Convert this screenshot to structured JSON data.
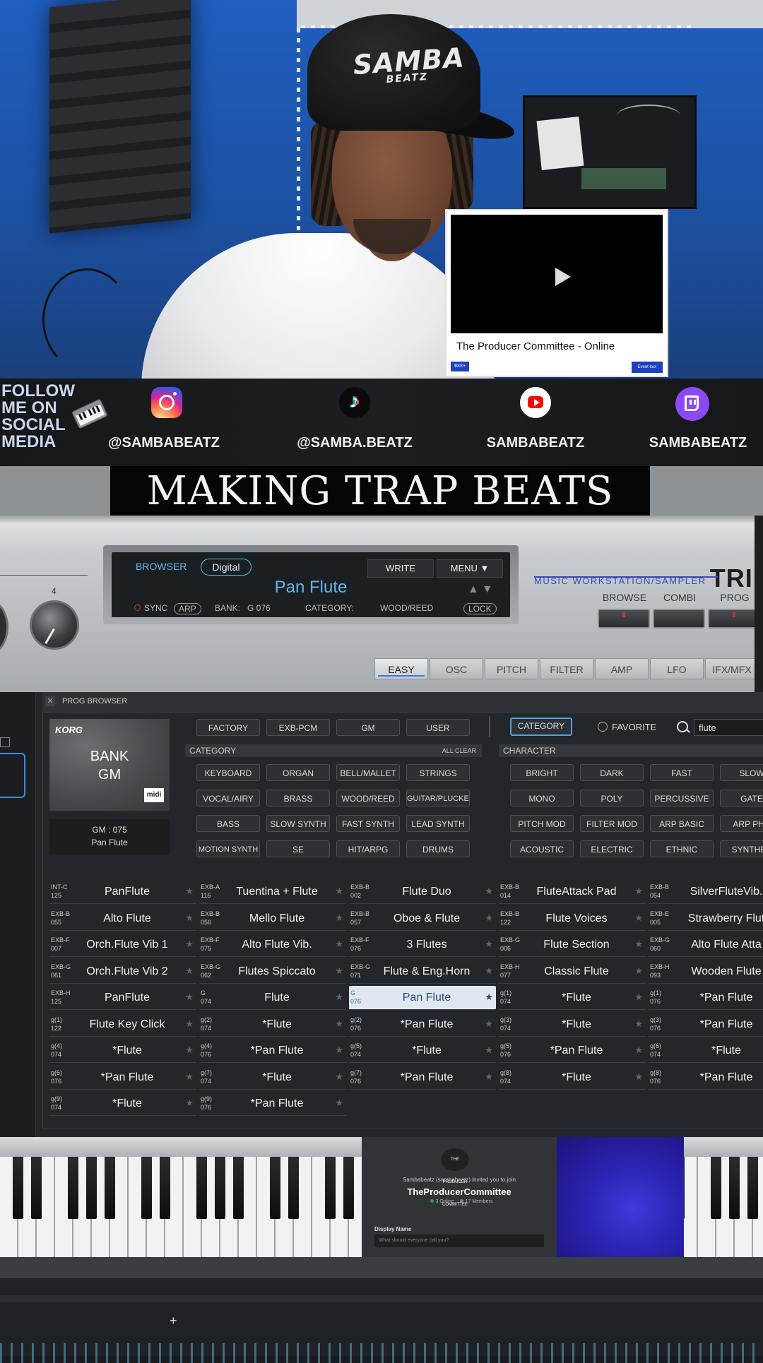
{
  "popup": {
    "title": "The Producer Committee - Online",
    "badge_left": "$900+",
    "badge_right": "Event too!"
  },
  "social": {
    "follow_text": "FOLLOW ME ON SOCIAL MEDIA",
    "instagram": "@SAMBABEATZ",
    "tiktok": "@SAMBA.BEATZ",
    "youtube": "SAMBABEATZ",
    "twitch": "SAMBABEATZ"
  },
  "stream_title": "MAKING TRAP BEATS",
  "cap_text": "SAMBA",
  "cap_subtext": "BEATZ",
  "synth": {
    "knob_number": "4",
    "display": {
      "browser_label": "BROWSER",
      "mode_pill": "Digital",
      "write": "WRITE",
      "menu": "MENU ▼",
      "patch_name": "Pan Flute",
      "sync": "SYNC",
      "arp": "ARP",
      "bank_label": "BANK:",
      "bank_value": "G 076",
      "category_label": "CATEGORY:",
      "category_value": "WOOD/REED",
      "lock": "LOCK"
    },
    "brand_text": "MUSIC WORKSTATION/SAMPLER",
    "brand_model": "TRI",
    "modes": [
      "BROWSE",
      "COMBI",
      "PROG"
    ],
    "tabs": [
      "EASY",
      "OSC",
      "PITCH",
      "FILTER",
      "AMP",
      "LFO",
      "IFX/MFX"
    ],
    "active_tab": "EASY"
  },
  "browser": {
    "header": "PROG BROWSER",
    "close": "✕",
    "bank_card": {
      "brand": "KORG",
      "bank_line1": "BANK",
      "bank_line2": "GM",
      "badge": "midi",
      "info_line1": "GM : 075",
      "info_line2": "Pan Flute"
    },
    "sources": [
      "FACTORY",
      "EXB-PCM",
      "GM",
      "USER"
    ],
    "category_toggle": "CATEGORY",
    "favorite": "FAVORITE",
    "search_value": "flute",
    "category_header": "CATEGORY",
    "all_clear": "ALL CLEAR",
    "character_header": "CHARACTER",
    "categories": [
      [
        "KEYBOARD",
        "ORGAN",
        "BELL/MALLET",
        "STRINGS"
      ],
      [
        "VOCAL/AIRY",
        "BRASS",
        "WOOD/REED",
        "GUITAR/PLUCKED"
      ],
      [
        "BASS",
        "SLOW SYNTH",
        "FAST SYNTH",
        "LEAD SYNTH"
      ],
      [
        "MOTION SYNTH",
        "SE",
        "HIT/ARPG",
        "DRUMS"
      ]
    ],
    "characters": [
      [
        "BRIGHT",
        "DARK",
        "FAST",
        "SLOW"
      ],
      [
        "MONO",
        "POLY",
        "PERCUSSIVE",
        "GATE"
      ],
      [
        "PITCH MOD",
        "FILTER MOD",
        "ARP BASIC",
        "ARP PHR"
      ],
      [
        "ACOUSTIC",
        "ELECTRIC",
        "ETHNIC",
        "SYNTHES"
      ]
    ],
    "results": [
      [
        {
          "bank": "INT-C",
          "num": "125",
          "name": "PanFlute"
        },
        {
          "bank": "EXB-A",
          "num": "116",
          "name": "Tuentina + Flute"
        },
        {
          "bank": "EXB-B",
          "num": "002",
          "name": "Flute Duo"
        },
        {
          "bank": "EXB-B",
          "num": "014",
          "name": "FluteAttack Pad"
        },
        {
          "bank": "EXB-B",
          "num": "054",
          "name": "SilverFluteVib."
        }
      ],
      [
        {
          "bank": "EXB-B",
          "num": "055",
          "name": "Alto Flute"
        },
        {
          "bank": "EXB-B",
          "num": "056",
          "name": "Mello Flute"
        },
        {
          "bank": "EXB-B",
          "num": "057",
          "name": "Oboe & Flute"
        },
        {
          "bank": "EXB-B",
          "num": "122",
          "name": "Flute Voices"
        },
        {
          "bank": "EXB-E",
          "num": "005",
          "name": "Strawberry Flut"
        }
      ],
      [
        {
          "bank": "EXB-F",
          "num": "007",
          "name": "Orch.Flute Vib 1"
        },
        {
          "bank": "EXB-F",
          "num": "075",
          "name": "Alto Flute Vib."
        },
        {
          "bank": "EXB-F",
          "num": "076",
          "name": "3 Flutes"
        },
        {
          "bank": "EXB-G",
          "num": "006",
          "name": "Flute Section"
        },
        {
          "bank": "EXB-G",
          "num": "060",
          "name": "Alto Flute Atta"
        }
      ],
      [
        {
          "bank": "EXB-G",
          "num": "061",
          "name": "Orch.Flute Vib 2"
        },
        {
          "bank": "EXB-G",
          "num": "062",
          "name": "Flutes Spiccato"
        },
        {
          "bank": "EXB-G",
          "num": "071",
          "name": "Flute & Eng.Horn"
        },
        {
          "bank": "EXB-H",
          "num": "077",
          "name": "Classic Flute"
        },
        {
          "bank": "EXB-H",
          "num": "093",
          "name": "Wooden Flute"
        }
      ],
      [
        {
          "bank": "EXB-H",
          "num": "125",
          "name": "PanFlute"
        },
        {
          "bank": "G",
          "num": "074",
          "name": "Flute"
        },
        {
          "bank": "G",
          "num": "076",
          "name": "Pan Flute",
          "selected": true
        },
        {
          "bank": "g(1)",
          "num": "074",
          "name": "*Flute"
        },
        {
          "bank": "g(1)",
          "num": "076",
          "name": "*Pan Flute"
        }
      ],
      [
        {
          "bank": "g(1)",
          "num": "122",
          "name": "Flute Key Click"
        },
        {
          "bank": "g(2)",
          "num": "074",
          "name": "*Flute"
        },
        {
          "bank": "g(2)",
          "num": "076",
          "name": "*Pan Flute"
        },
        {
          "bank": "g(3)",
          "num": "074",
          "name": "*Flute"
        },
        {
          "bank": "g(3)",
          "num": "076",
          "name": "*Pan Flute"
        }
      ],
      [
        {
          "bank": "g(4)",
          "num": "074",
          "name": "*Flute"
        },
        {
          "bank": "g(4)",
          "num": "076",
          "name": "*Pan Flute"
        },
        {
          "bank": "g(5)",
          "num": "074",
          "name": "*Flute"
        },
        {
          "bank": "g(5)",
          "num": "076",
          "name": "*Pan Flute"
        },
        {
          "bank": "g(6)",
          "num": "074",
          "name": "*Flute"
        }
      ],
      [
        {
          "bank": "g(6)",
          "num": "076",
          "name": "*Pan Flute"
        },
        {
          "bank": "g(7)",
          "num": "074",
          "name": "*Flute"
        },
        {
          "bank": "g(7)",
          "num": "076",
          "name": "*Pan Flute"
        },
        {
          "bank": "g(8)",
          "num": "074",
          "name": "*Flute"
        },
        {
          "bank": "g(8)",
          "num": "076",
          "name": "*Pan Flute"
        }
      ],
      [
        {
          "bank": "g(9)",
          "num": "074",
          "name": "*Flute"
        },
        {
          "bank": "g(9)",
          "num": "076",
          "name": "*Pan Flute"
        }
      ]
    ]
  },
  "discord": {
    "logo_text": "THE PRODUCER COMMITTEE",
    "invite_text": "Sambabeatz (sambabeatz) invited you to join",
    "server_name": "TheProducerCommittee",
    "online": "3 Online",
    "members": "17 Members",
    "display_name_label": "Display Name",
    "display_name_placeholder": "What should everyone call you?"
  },
  "timeline": {
    "add": "+"
  },
  "colors": {
    "wall_blue": "#1f5fc0",
    "synth_accent": "#5fb7ea",
    "brand_blue": "#3b4bb7",
    "selected_row": "#dfe7f1",
    "twitch": "#8a49f5",
    "youtube": "#ff0000"
  }
}
